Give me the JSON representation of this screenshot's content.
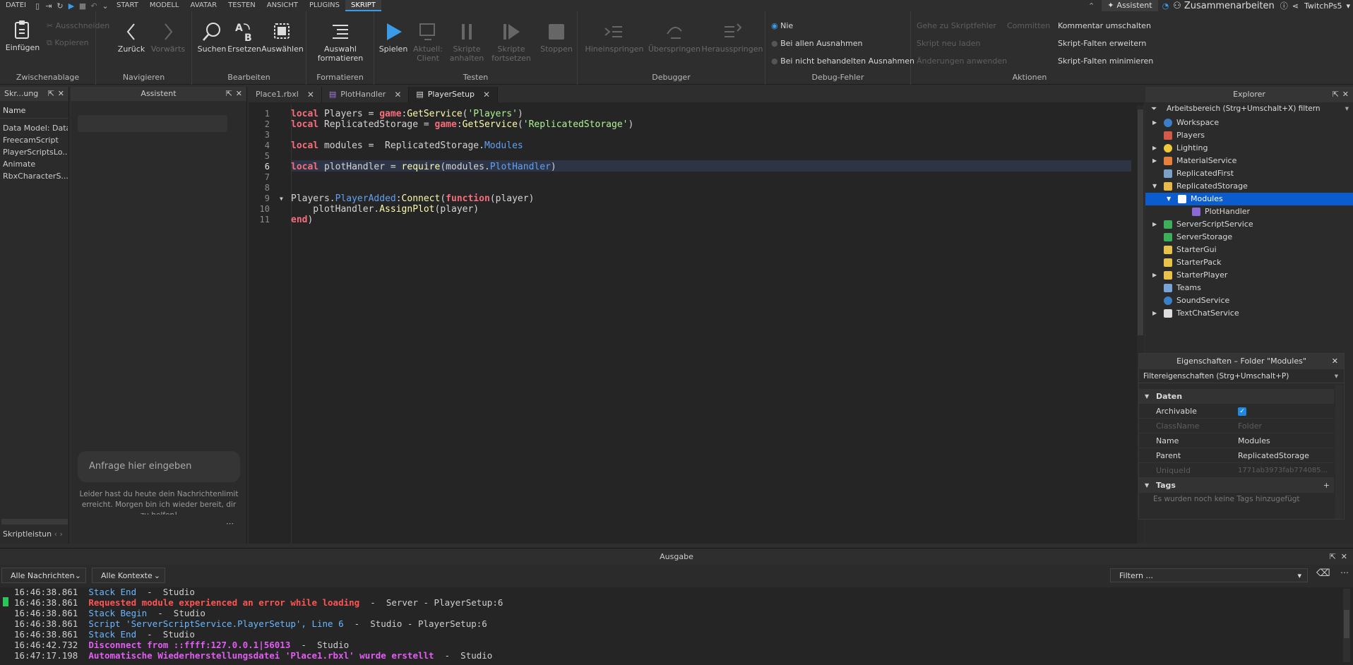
{
  "menubar": {
    "file": "DATEI",
    "tabs": [
      "START",
      "MODELL",
      "AVATAR",
      "TESTEN",
      "ANSICHT",
      "PLUGINS",
      "SKRIPT"
    ],
    "active_tab": "SKRIPT",
    "assistant": "Assistent",
    "collaborate": "Zusammenarbeiten",
    "user": "TwitchPs5"
  },
  "ribbon": {
    "clipboard": {
      "paste": "Einfügen",
      "cut": "Ausschneiden",
      "copy": "Kopieren",
      "group": "Zwischenablage"
    },
    "navigate": {
      "back": "Zurück",
      "forward": "Vorwärts",
      "group": "Navigieren"
    },
    "edit": {
      "find": "Suchen",
      "replace": "Ersetzen",
      "select": "Auswählen",
      "group": "Bearbeiten"
    },
    "format": {
      "label1": "Auswahl",
      "label2": "formatieren",
      "group": "Formatieren"
    },
    "test": {
      "play": "Spielen",
      "client1": "Aktuell:",
      "client2": "Client",
      "pause1": "Skripte",
      "pause2": "anhalten",
      "resume1": "Skripte",
      "resume2": "fortsetzen",
      "stop": "Stoppen",
      "group": "Testen"
    },
    "debugger": {
      "step_in": "Hineinspringen",
      "step_over": "Überspringen",
      "step_out": "Herausspringen",
      "group": "Debugger"
    },
    "debug_errors": {
      "never": "Nie",
      "all": "Bei allen Ausnahmen",
      "unhandled": "Bei nicht behandelten Ausnahmen",
      "group": "Debug-Fehler"
    },
    "actions": {
      "goto_error": "Gehe zu Skriptfehler",
      "reload": "Skript neu laden",
      "apply": "Änderungen anwenden",
      "commit": "Committen",
      "toggle_comment": "Kommentar umschalten",
      "expand": "Skript-Falten erweitern",
      "collapse": "Skript-Falten minimieren",
      "group": "Aktionen"
    }
  },
  "left_panel": {
    "title": "Skr...ung",
    "header": "Name",
    "items": [
      "Data Model: Data M",
      "FreecamScript",
      "PlayerScriptsLo...",
      "Animate",
      "RbxCharacterS..."
    ],
    "footer": "Skriptleistun"
  },
  "assistant_panel": {
    "title": "Assistent",
    "placeholder": "Anfrage hier eingeben",
    "limit_msg": "Leider hast du heute dein Nachrichtenlimit erreicht. Morgen bin ich wieder bereit, dir zu helfen!"
  },
  "editor": {
    "tabs": [
      {
        "label": "Place1.rbxl"
      },
      {
        "label": "PlotHandler"
      },
      {
        "label": "PlayerSetup"
      }
    ],
    "line_numbers": [
      "1",
      "2",
      "3",
      "4",
      "5",
      "6",
      "7",
      "8",
      "9",
      "10",
      "11"
    ]
  },
  "explorer": {
    "title": "Explorer",
    "filter": "Arbeitsbereich (Strg+Umschalt+X) filtern",
    "items": [
      "Workspace",
      "Players",
      "Lighting",
      "MaterialService",
      "ReplicatedFirst",
      "ReplicatedStorage",
      "Modules",
      "PlotHandler",
      "ServerScriptService",
      "ServerStorage",
      "StarterGui",
      "StarterPack",
      "StarterPlayer",
      "Teams",
      "SoundService",
      "TextChatService"
    ]
  },
  "properties": {
    "title": "Eigenschaften – Folder \"Modules\"",
    "filter": "Filtereigenschaften (Strg+Umschalt+P)",
    "section_data": "Daten",
    "rows": [
      {
        "k": "Archivable",
        "v": ""
      },
      {
        "k": "ClassName",
        "v": "Folder"
      },
      {
        "k": "Name",
        "v": "Modules"
      },
      {
        "k": "Parent",
        "v": "ReplicatedStorage"
      },
      {
        "k": "UniqueId",
        "v": "1771ab3973fab774085..."
      }
    ],
    "section_tags": "Tags",
    "no_tags": "Es wurden noch keine Tags hinzugefügt"
  },
  "output": {
    "title": "Ausgabe",
    "filter_messages": "Alle Nachrichten",
    "filter_contexts": "Alle Kontexte",
    "filter_placeholder": "Filtern ...",
    "lines": [
      {
        "time": "16:46:38.861",
        "text": "Stack End",
        "suffix": "  -  Studio"
      },
      {
        "time": "16:46:38.861",
        "text": "Requested module experienced an error while loading",
        "suffix": "  -  Server - PlayerSetup:6"
      },
      {
        "time": "16:46:38.861",
        "text": "Stack Begin",
        "suffix": "  -  Studio"
      },
      {
        "time": "16:46:38.861",
        "text": "Script 'ServerScriptService.PlayerSetup', Line 6",
        "suffix": "  -  Studio - PlayerSetup:6"
      },
      {
        "time": "16:46:38.861",
        "text": "Stack End",
        "suffix": "  -  Studio"
      },
      {
        "time": "16:46:42.732",
        "text": "Disconnect from ::ffff:127.0.0.1|56013",
        "suffix": "  -  Studio"
      },
      {
        "time": "16:47:17.198",
        "text": "Automatische Wiederherstellungsdatei 'Place1.rbxl' wurde erstellt",
        "suffix": "  -  Studio"
      }
    ]
  }
}
